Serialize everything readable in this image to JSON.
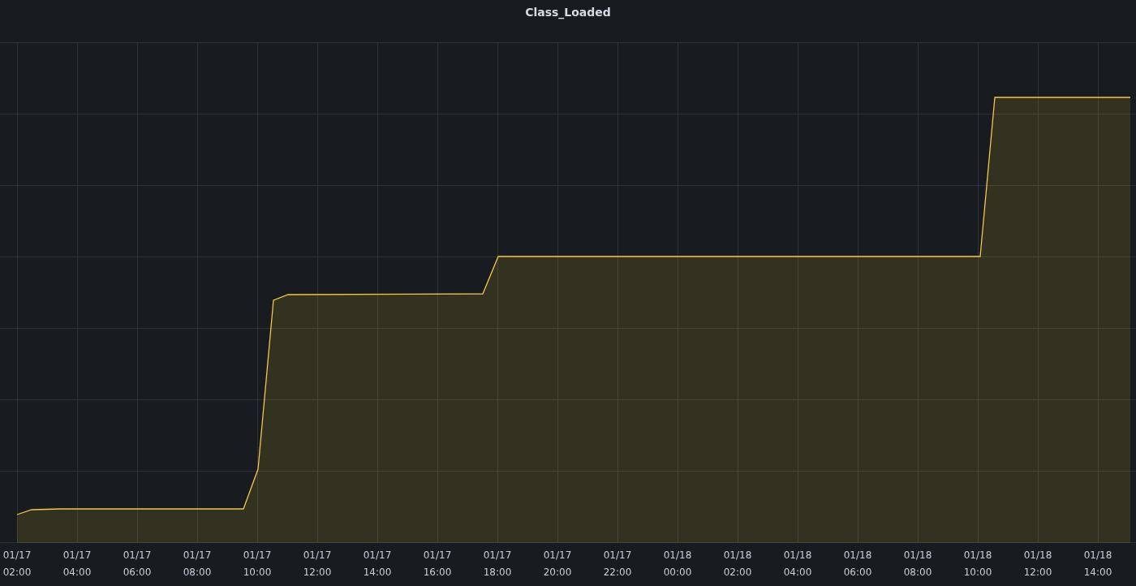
{
  "panel": {
    "title": "Class_Loaded",
    "x_axis_labels": [
      {
        "date": "01/17",
        "time": "02:00"
      },
      {
        "date": "01/17",
        "time": "04:00"
      },
      {
        "date": "01/17",
        "time": "06:00"
      },
      {
        "date": "01/17",
        "time": "08:00"
      },
      {
        "date": "01/17",
        "time": "10:00"
      },
      {
        "date": "01/17",
        "time": "12:00"
      },
      {
        "date": "01/17",
        "time": "14:00"
      },
      {
        "date": "01/17",
        "time": "16:00"
      },
      {
        "date": "01/17",
        "time": "18:00"
      },
      {
        "date": "01/17",
        "time": "20:00"
      },
      {
        "date": "01/17",
        "time": "22:00"
      },
      {
        "date": "01/18",
        "time": "00:00"
      },
      {
        "date": "01/18",
        "time": "02:00"
      },
      {
        "date": "01/18",
        "time": "04:00"
      },
      {
        "date": "01/18",
        "time": "06:00"
      },
      {
        "date": "01/18",
        "time": "08:00"
      },
      {
        "date": "01/18",
        "time": "10:00"
      },
      {
        "date": "01/18",
        "time": "12:00"
      },
      {
        "date": "01/18",
        "time": "14:00"
      }
    ]
  }
}
